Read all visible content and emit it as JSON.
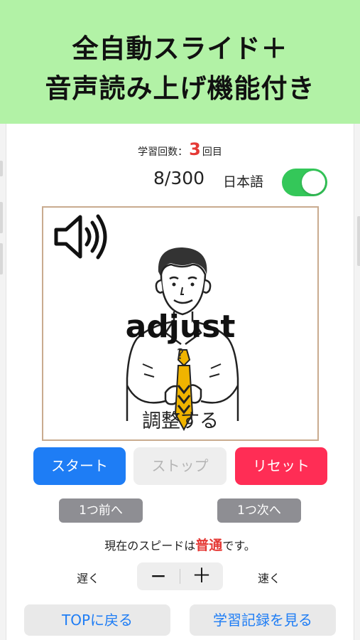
{
  "banner": {
    "line1": "全自動スライド＋",
    "line2": "音声読み上げ機能付き"
  },
  "study_count": {
    "label": "学習回数：",
    "value": "3",
    "suffix": "回目"
  },
  "progress": "8/300",
  "language_toggle": {
    "label": "日本語",
    "on": true,
    "on_color": "#34c759"
  },
  "card": {
    "speaker_icon": "speaker-volume-icon",
    "word": "adjust",
    "hint": "?",
    "meaning": "調整する"
  },
  "controls": {
    "start": "スタート",
    "stop": "ストップ",
    "reset": "リセット",
    "prev": "1つ前へ",
    "next": "1つ次へ"
  },
  "speed": {
    "prefix": "現在のスピードは",
    "value": "普通",
    "suffix": "です。",
    "slow_label": "遅く",
    "fast_label": "速く",
    "minus": "−",
    "plus": "＋"
  },
  "footer": {
    "top_button": "TOPに戻る",
    "record_button": "学習記録を見る"
  },
  "colors": {
    "banner_bg": "#b2f2a6",
    "start": "#1e7df5",
    "reset": "#ff2d55",
    "accent_red": "#e53935",
    "link_blue": "#1e7df5"
  }
}
